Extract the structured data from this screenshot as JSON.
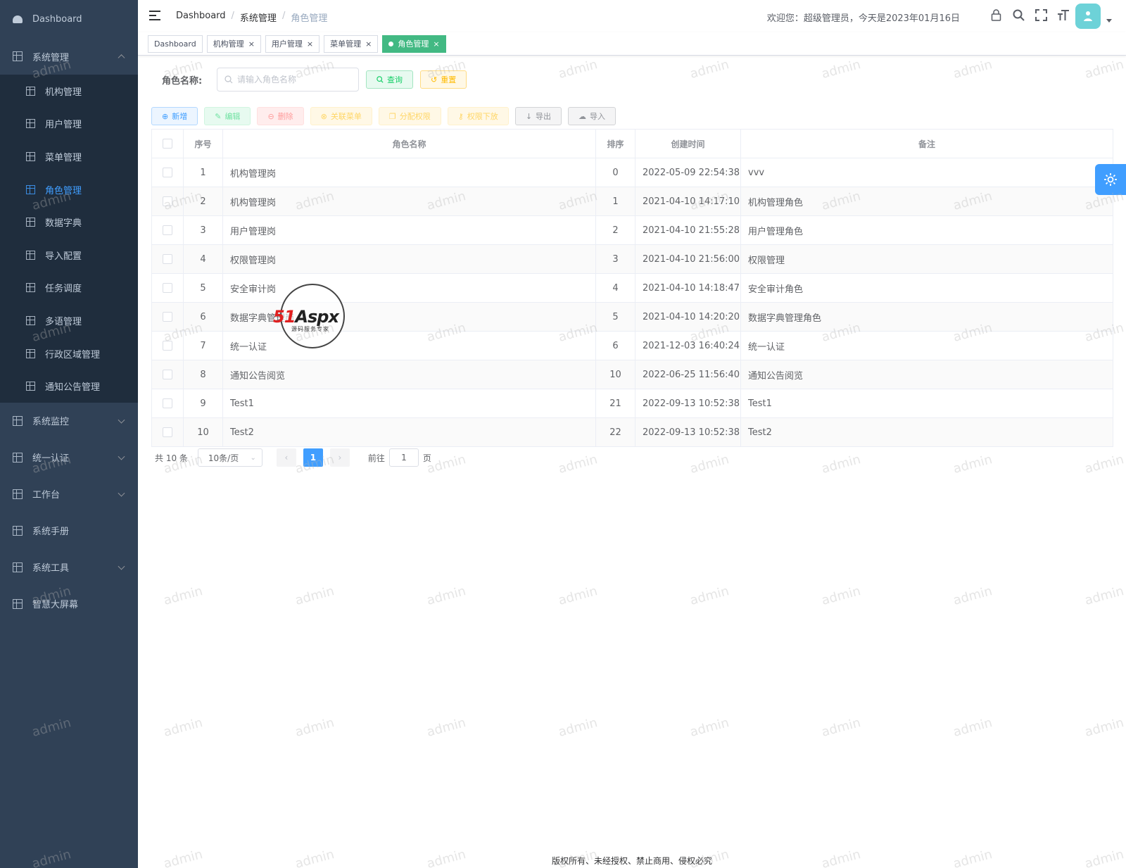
{
  "sidebar": {
    "dashboard": "Dashboard",
    "system_mgmt": "系统管理",
    "sub_items": [
      "机构管理",
      "用户管理",
      "菜单管理",
      "角色管理",
      "数据字典",
      "导入配置",
      "任务调度",
      "多语管理",
      "行政区域管理",
      "通知公告管理"
    ],
    "active_sub": "角色管理",
    "other_items": [
      "系统监控",
      "统一认证",
      "工作台",
      "系统手册",
      "系统工具",
      "智慧大屏幕"
    ]
  },
  "header": {
    "breadcrumb": [
      "Dashboard",
      "系统管理",
      "角色管理"
    ],
    "welcome": "欢迎您：超级管理员，今天是2023年01月16日"
  },
  "tags": [
    "Dashboard",
    "机构管理",
    "用户管理",
    "菜单管理",
    "角色管理"
  ],
  "search": {
    "label": "角色名称:",
    "placeholder": "请输入角色名称",
    "query": "查询",
    "reset": "重置"
  },
  "toolbar": {
    "add": "新增",
    "edit": "编辑",
    "delete": "删除",
    "menu": "关联菜单",
    "perm": "分配权限",
    "push": "权限下放",
    "export": "导出",
    "import": "导入"
  },
  "table": {
    "headers": [
      "序号",
      "角色名称",
      "排序",
      "创建时间",
      "备注"
    ],
    "rows": [
      {
        "idx": "1",
        "name": "机构管理岗",
        "sort": "0",
        "time": "2022-05-09 22:54:38",
        "remark": "vvv"
      },
      {
        "idx": "2",
        "name": "机构管理岗",
        "sort": "1",
        "time": "2021-04-10 14:17:10",
        "remark": "机构管理角色"
      },
      {
        "idx": "3",
        "name": "用户管理岗",
        "sort": "2",
        "time": "2021-04-10 21:55:28",
        "remark": "用户管理角色"
      },
      {
        "idx": "4",
        "name": "权限管理岗",
        "sort": "3",
        "time": "2021-04-10 21:56:00",
        "remark": "权限管理"
      },
      {
        "idx": "5",
        "name": "安全审计岗",
        "sort": "4",
        "time": "2021-04-10 14:18:47",
        "remark": "安全审计角色"
      },
      {
        "idx": "6",
        "name": "数据字典管理岗",
        "sort": "5",
        "time": "2021-04-10 14:20:20",
        "remark": "数据字典管理角色"
      },
      {
        "idx": "7",
        "name": "统一认证",
        "sort": "6",
        "time": "2021-12-03 16:40:24",
        "remark": "统一认证"
      },
      {
        "idx": "8",
        "name": "通知公告阅览",
        "sort": "10",
        "time": "2022-06-25 11:56:40",
        "remark": "通知公告阅览"
      },
      {
        "idx": "9",
        "name": "Test1",
        "sort": "21",
        "time": "2022-09-13 10:52:38",
        "remark": "Test1"
      },
      {
        "idx": "10",
        "name": "Test2",
        "sort": "22",
        "time": "2022-09-13 10:52:38",
        "remark": "Test2"
      }
    ]
  },
  "pagination": {
    "total": "共 10 条",
    "page_size": "10条/页",
    "current": "1",
    "goto": "前往",
    "goto_value": "1",
    "page_unit": "页"
  },
  "footer": "版权所有、未经授权、禁止商用、侵权必究",
  "logo": {
    "red": "51",
    "black": "Aspx",
    "sub": "源码服务专家"
  },
  "watermark": "admin",
  "colors": {
    "sidebar": "#304156",
    "submenu": "#1f2d3d",
    "primary": "#409eff",
    "tag_active": "#42b983"
  }
}
